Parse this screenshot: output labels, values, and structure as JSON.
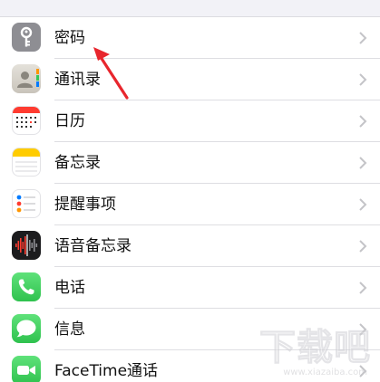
{
  "settings_list": {
    "items": [
      {
        "label": "密码",
        "icon": "key-icon",
        "color": "#8e8e93"
      },
      {
        "label": "通讯录",
        "icon": "contacts-icon",
        "color": "#c9c4bb"
      },
      {
        "label": "日历",
        "icon": "calendar-icon",
        "color": "#ff3b30"
      },
      {
        "label": "备忘录",
        "icon": "notes-icon",
        "color": "#ffcc00"
      },
      {
        "label": "提醒事项",
        "icon": "reminders-icon",
        "color": "#ffffff"
      },
      {
        "label": "语音备忘录",
        "icon": "voice-memos-icon",
        "color": "#1c1c1e"
      },
      {
        "label": "电话",
        "icon": "phone-icon",
        "color": "#34c759"
      },
      {
        "label": "信息",
        "icon": "messages-icon",
        "color": "#34c759"
      },
      {
        "label": "FaceTime通话",
        "icon": "facetime-icon",
        "color": "#34c759"
      }
    ]
  },
  "annotation": {
    "icon": "red-arrow-icon",
    "color": "#e8262d"
  },
  "watermark": {
    "main": "下载吧",
    "sub": "www.xiazaiba.com"
  }
}
